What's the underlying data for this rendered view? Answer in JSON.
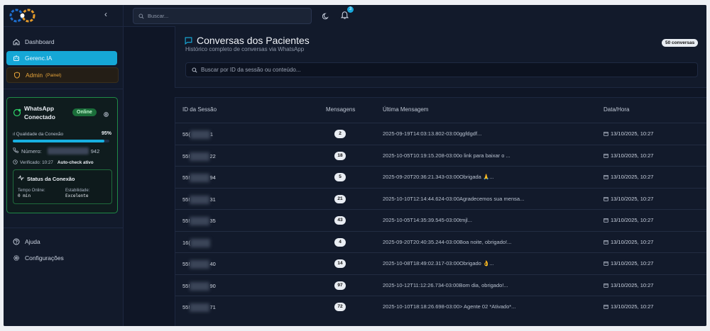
{
  "sidebar": {
    "collapse_glyph": "‹",
    "nav": [
      {
        "label": "Dashboard",
        "icon": "home-icon"
      },
      {
        "label": "Gerenc.IA",
        "icon": "bot-icon"
      },
      {
        "label": "Admin",
        "sub": "(Painel)",
        "icon": "shield-icon"
      }
    ],
    "whatsapp": {
      "title_line1": "WhatsApp",
      "title_line2": "Conectado",
      "badge": "Online",
      "quality_label": "Qualidade da Conexão",
      "quality_value": "95%",
      "quality_fraction": 0.95,
      "number_label": "Número:",
      "number_suffix": "942",
      "verified": "Verificado: 10:27",
      "auto_check": "Auto-check ativo",
      "status_title": "Status da Conexão",
      "uptime_label": "Tempo Online:",
      "uptime_value": "0 min",
      "stability_label": "Estabilidade:",
      "stability_value": "Excelente"
    },
    "bottom": [
      {
        "label": "Ajuda",
        "icon": "help-icon"
      },
      {
        "label": "Configurações",
        "icon": "gear-icon"
      }
    ]
  },
  "topbar": {
    "search_placeholder": "Buscar...",
    "notifications": "3"
  },
  "page": {
    "title": "Conversas dos Pacientes",
    "subtitle": "Histórico completo de conversas via WhatsApp",
    "count_badge": "50 conversas",
    "search_placeholder": "Buscar por ID da sessão ou conteúdo..."
  },
  "table": {
    "headers": [
      "ID da Sessão",
      "Mensagens",
      "Última Mensagem",
      "Data/Hora"
    ],
    "rows": [
      {
        "id_prefix": "55(",
        "id_suffix": "1",
        "count": "2",
        "last": "2025-09-19T14:03:13.802-03:00ggfdgdf...",
        "date": "13/10/2025, 10:27"
      },
      {
        "id_prefix": "55!",
        "id_suffix": "22",
        "count": "18",
        "last": "2025-10-05T10:19:15.208-03:00o link para baixar o ...",
        "date": "13/10/2025, 10:27"
      },
      {
        "id_prefix": "55!",
        "id_suffix": "94",
        "count": "5",
        "last": "2025-09-20T20:36:21.343-03:00Obrigada 🙏...",
        "date": "13/10/2025, 10:27"
      },
      {
        "id_prefix": "55!",
        "id_suffix": "31",
        "count": "21",
        "last": "2025-10-10T12:14:44.624-03:00Agradecemos sua mensa...",
        "date": "13/10/2025, 10:27"
      },
      {
        "id_prefix": "55!",
        "id_suffix": "35",
        "count": "43",
        "last": "2025-10-05T14:35:39.545-03:00tmjl...",
        "date": "13/10/2025, 10:27"
      },
      {
        "id_prefix": "16(",
        "id_suffix": "",
        "count": "4",
        "last": "2025-09-20T20:40:35.244-03:00Boa noite, obrigado!...",
        "date": "13/10/2025, 10:27"
      },
      {
        "id_prefix": "55!",
        "id_suffix": "40",
        "count": "14",
        "last": "2025-10-08T18:49:02.317-03:00Obrigado 👌...",
        "date": "13/10/2025, 10:27"
      },
      {
        "id_prefix": "55!",
        "id_suffix": "90",
        "count": "97",
        "last": "2025-10-12T11:12:26.734-03:00Bom dia, obrigado!...",
        "date": "13/10/2025, 10:27"
      },
      {
        "id_prefix": "55!",
        "id_suffix": "71",
        "count": "72",
        "last": "2025-10-10T18:18:26.698-03:00> Agente 02 *Ativado*...",
        "date": "13/10/2025, 10:27"
      }
    ]
  },
  "colors": {
    "accent": "#15a7d6",
    "online": "#1b6e3a",
    "admin": "#e8a53a",
    "background": "#0f1626"
  }
}
